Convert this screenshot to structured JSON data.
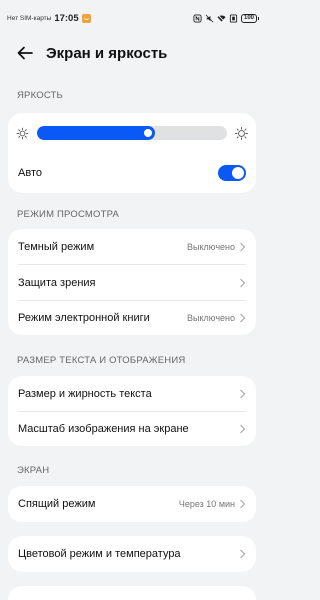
{
  "status_bar": {
    "carrier": "Нет SIM-карты",
    "time": "17:05",
    "battery": "100"
  },
  "header": {
    "title": "Экран и яркость"
  },
  "brightness": {
    "section": "ЯРКОСТЬ",
    "level": 0.62,
    "auto_label": "Авто",
    "auto_on": true
  },
  "view_mode": {
    "section": "РЕЖИМ ПРОСМОТРА",
    "items": [
      {
        "label": "Темный режим",
        "value": "Выключено"
      },
      {
        "label": "Защита зрения",
        "value": ""
      },
      {
        "label": "Режим электронной книги",
        "value": "Выключено"
      }
    ]
  },
  "text_display": {
    "section": "РАЗМЕР ТЕКСТА И ОТОБРАЖЕНИЯ",
    "items": [
      {
        "label": "Размер и жирность текста"
      },
      {
        "label": "Масштаб изображения на экране"
      }
    ]
  },
  "screen": {
    "section": "ЭКРАН",
    "sleep_label": "Спящий режим",
    "sleep_value": "Через 10 мин",
    "color_label": "Цветовой режим и температура"
  },
  "colors": {
    "accent": "#0a59f7",
    "background": "#f1f3f5"
  }
}
